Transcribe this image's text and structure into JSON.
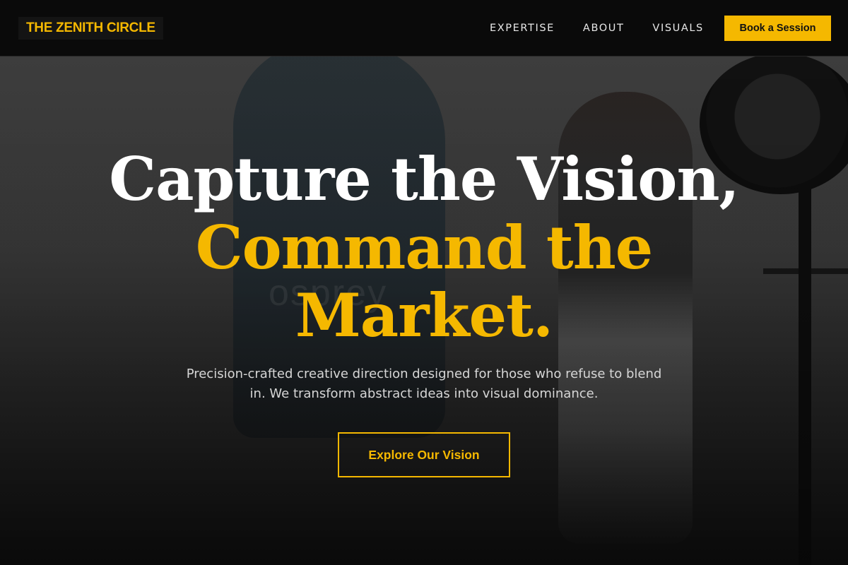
{
  "brand": {
    "name": "THE ZENITH CIRCLE"
  },
  "nav": {
    "links": [
      {
        "label": "EXPERTISE"
      },
      {
        "label": "ABOUT"
      },
      {
        "label": "VISUALS"
      }
    ],
    "cta_label": "Book a Session"
  },
  "hero": {
    "headline_line1": "Capture the Vision,",
    "headline_line2": "Command the",
    "headline_line3": "Market.",
    "subtext": "Precision-crafted creative direction designed for those who refuse to blend in. We transform abstract ideas into visual dominance.",
    "button_label": "Explore Our Vision",
    "watermark": "osprey"
  },
  "colors": {
    "accent": "#f5b800",
    "nav_background": "#0a0a0a",
    "headline_primary": "#ffffff"
  }
}
